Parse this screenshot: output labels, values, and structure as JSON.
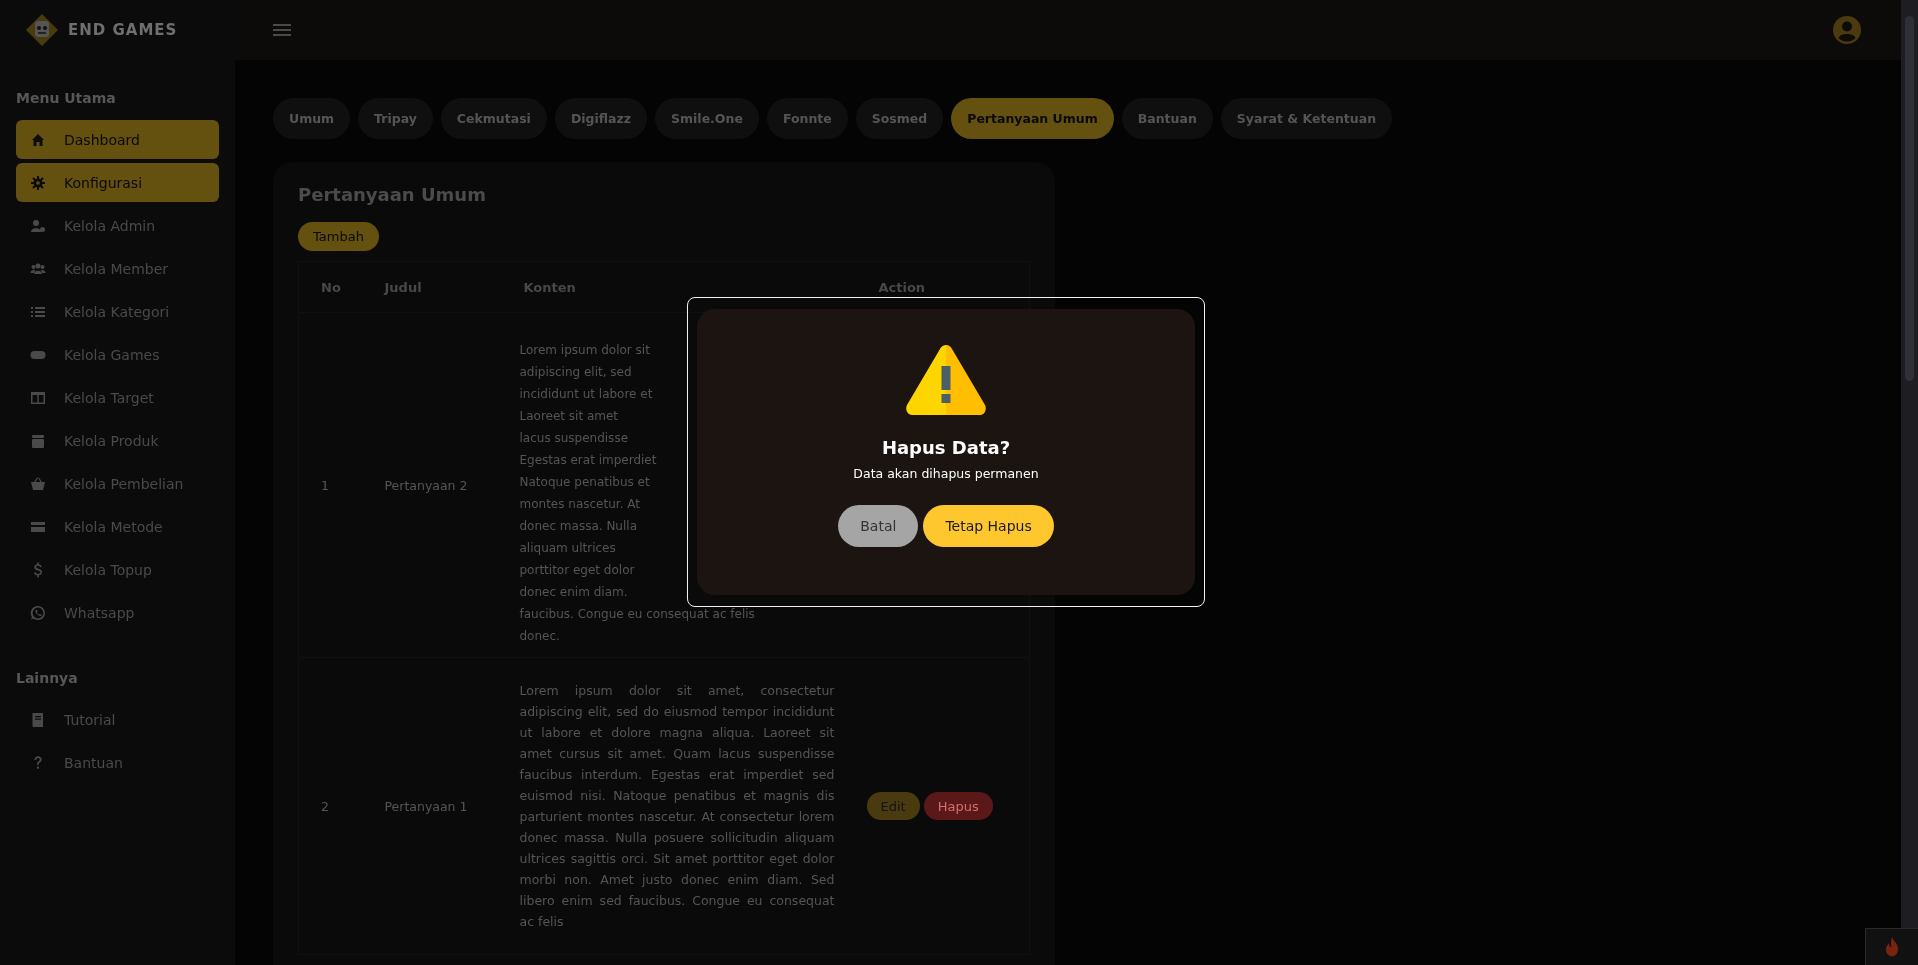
{
  "brand": {
    "name": "END GAMES"
  },
  "sidebar": {
    "sections": [
      {
        "title": "Menu Utama",
        "items": [
          {
            "label": "Dashboard",
            "selected": true
          },
          {
            "label": "Konfigurasi",
            "selected": true
          },
          {
            "label": "Kelola Admin",
            "selected": false
          },
          {
            "label": "Kelola Member",
            "selected": false
          },
          {
            "label": "Kelola Kategori",
            "selected": false
          },
          {
            "label": "Kelola Games",
            "selected": false
          },
          {
            "label": "Kelola Target",
            "selected": false
          },
          {
            "label": "Kelola Produk",
            "selected": false
          },
          {
            "label": "Kelola Pembelian",
            "selected": false
          },
          {
            "label": "Kelola Metode",
            "selected": false
          },
          {
            "label": "Kelola Topup",
            "selected": false
          },
          {
            "label": "Whatsapp",
            "selected": false
          }
        ]
      },
      {
        "title": "Lainnya",
        "items": [
          {
            "label": "Tutorial",
            "selected": false
          },
          {
            "label": "Bantuan",
            "selected": false
          }
        ]
      }
    ]
  },
  "tabs": [
    {
      "label": "Umum",
      "selected": false
    },
    {
      "label": "Tripay",
      "selected": false
    },
    {
      "label": "Cekmutasi",
      "selected": false
    },
    {
      "label": "Digiflazz",
      "selected": false
    },
    {
      "label": "Smile.One",
      "selected": false
    },
    {
      "label": "Fonnte",
      "selected": false
    },
    {
      "label": "Sosmed",
      "selected": false
    },
    {
      "label": "Pertanyaan Umum",
      "selected": true
    },
    {
      "label": "Bantuan",
      "selected": false
    },
    {
      "label": "Syarat & Ketentuan",
      "selected": false
    }
  ],
  "card": {
    "title": "Pertanyaan Umum",
    "add_button": "Tambah",
    "table": {
      "columns": [
        "No",
        "Judul",
        "Konten",
        "Action"
      ],
      "rows": [
        {
          "no": "1",
          "title": "Pertanyaan 2",
          "content_lines": [
            "Lorem ipsum dolor sit",
            "adipiscing elit, sed",
            "incididunt ut labore et",
            "Laoreet sit amet",
            "lacus suspendisse",
            "Egestas erat imperdiet",
            "Natoque penatibus et",
            "montes nascetur. At",
            "donec massa. Nulla",
            "aliquam ultrices",
            "porttitor eget dolor",
            "donec enim diam.",
            "faucibus. Congue eu consequat ac felis",
            "donec."
          ]
        },
        {
          "no": "2",
          "title": "Pertanyaan 1",
          "content": "Lorem ipsum dolor sit amet, consectetur adipiscing elit, sed do eiusmod tempor incididunt ut labore et dolore magna aliqua. Laoreet sit amet cursus sit amet. Quam lacus suspendisse faucibus interdum. Egestas erat imperdiet sed euismod nisi. Natoque penatibus et magnis dis parturient montes nascetur. At consectetur lorem donec massa. Nulla posuere sollicitudin aliquam ultrices sagittis orci. Sit amet porttitor eget dolor morbi non. Amet justo donec enim diam. Sed libero enim sed faucibus. Congue eu consequat ac felis",
          "actions": [
            {
              "label": "Edit",
              "kind": "edit"
            },
            {
              "label": "Hapus",
              "kind": "delete"
            }
          ]
        }
      ]
    }
  },
  "modal": {
    "title": "Hapus Data?",
    "message": "Data akan dihapus permanen",
    "buttons": [
      {
        "label": "Batal",
        "kind": "cancel"
      },
      {
        "label": "Tetap Hapus",
        "kind": "confirm"
      }
    ]
  }
}
